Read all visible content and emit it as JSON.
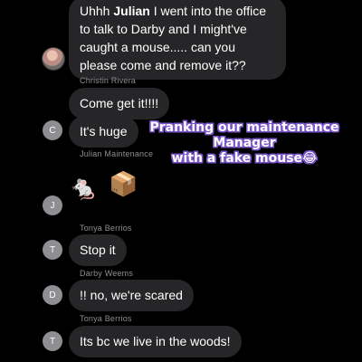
{
  "messages": [
    {
      "text_prefix": "Uhhh ",
      "text_bold": "Julian",
      "text_rest": " I went into the office to talk to Darby and I might've caught a mouse..... can you please come and remove it??"
    },
    {
      "sender": "Christin Rivera",
      "text": "Come get it!!!!"
    },
    {
      "avatar": "C",
      "text": "It's huge"
    },
    {
      "sender": "Julian Maintenance",
      "avatar": "J",
      "emoji": [
        "rat-emoji",
        "package-emoji"
      ]
    },
    {
      "sender": "Tonya Berrios",
      "avatar": "T",
      "text": "Stop it"
    },
    {
      "sender": "Darby Weems",
      "avatar": "D",
      "text": "!! no, we're scared"
    },
    {
      "sender": "Tonya Berrios",
      "avatar": "T",
      "text": "Its bc we live in the woods!"
    }
  ],
  "first_message_lines": [
    "to talk to Darby and I might've",
    "caught a mouse..... can you",
    "please come and remove it??"
  ],
  "overlay": {
    "lines": [
      "Pranking our maintenance",
      "Manager",
      "with a fake mouse😂"
    ],
    "outline_color": "#7a56c9"
  },
  "colors": {
    "background": "#000000",
    "bubble": "#262628",
    "sender_text": "#8e8e93",
    "avatar": "#8e8e93"
  }
}
